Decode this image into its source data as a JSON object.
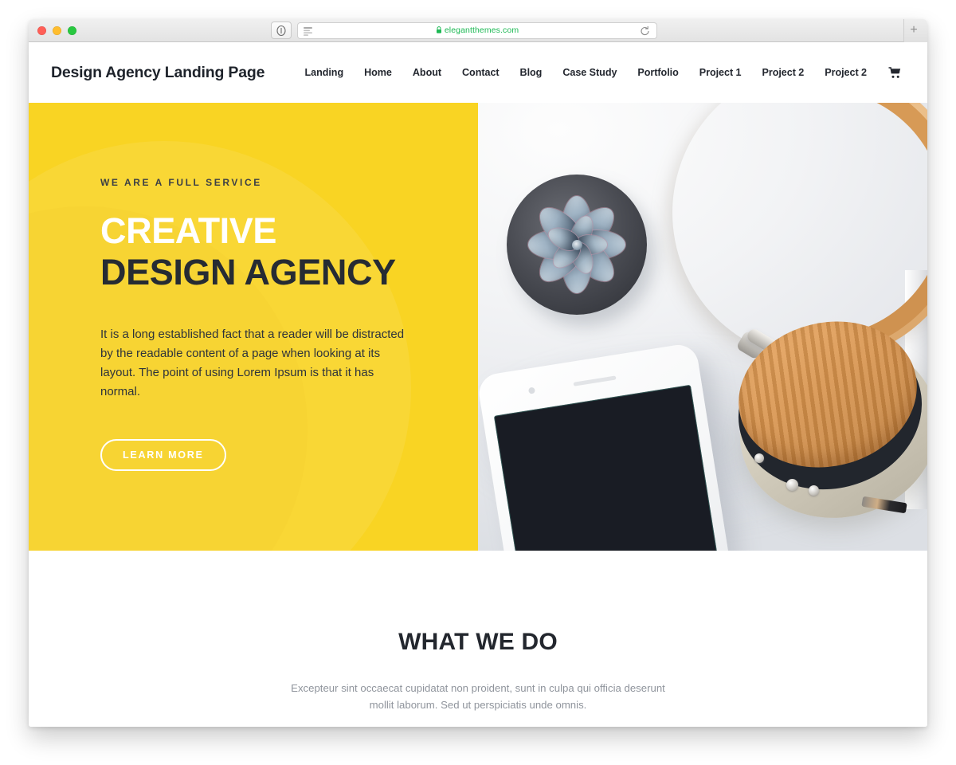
{
  "browser": {
    "traffic_lights": [
      "close",
      "minimize",
      "maximize"
    ],
    "shield_button_name": "privacy-report-button",
    "reader_icon_name": "reader-view-icon",
    "url": "elegantthemes.com",
    "lock_icon_name": "lock-icon",
    "reload_icon_name": "reload-icon",
    "new_tab_label": "+",
    "url_color": "#1db954"
  },
  "site": {
    "brand": "Design Agency Landing Page",
    "nav": [
      {
        "label": "Landing"
      },
      {
        "label": "Home"
      },
      {
        "label": "About"
      },
      {
        "label": "Contact"
      },
      {
        "label": "Blog"
      },
      {
        "label": "Case Study"
      },
      {
        "label": "Portfolio"
      },
      {
        "label": "Project 1"
      },
      {
        "label": "Project 2"
      },
      {
        "label": "Project 2"
      }
    ],
    "cart_icon_name": "shopping-cart-icon"
  },
  "hero": {
    "eyebrow": "WE ARE A FULL SERVICE",
    "headline_line1": "CREATIVE",
    "headline_line2": "DESIGN AGENCY",
    "paragraph": "It is a long established fact that a reader will be distracted by the readable content of a page when looking at its layout. The point of using Lorem Ipsum is that it has normal.",
    "cta_label": "LEARN MORE",
    "background_color": "#f9d423",
    "headline_line1_color": "#ffffff",
    "headline_line2_color": "#262b33",
    "photo_alt": "succulent plant, tan leather headphones and white smartphone on a desk"
  },
  "what_we_do": {
    "title": "WHAT WE DO",
    "subtitle": "Excepteur sint occaecat cupidatat non proident, sunt in culpa qui officia deserunt mollit laborum. Sed ut perspiciatis unde omnis."
  }
}
